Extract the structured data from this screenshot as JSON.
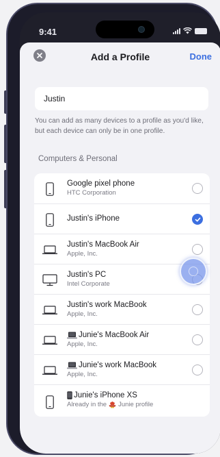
{
  "status_bar": {
    "time": "9:41"
  },
  "nav": {
    "title": "Add a Profile",
    "done_label": "Done"
  },
  "profile_name": {
    "value": "Justin"
  },
  "helper_text": "You can add as many devices to a profile as you'd like, but each device can only be in one profile.",
  "section_title": "Computers & Personal",
  "devices": [
    {
      "icon": "phone-icon",
      "title": "Google pixel phone",
      "subtitle": "HTC Corporation",
      "selected": false
    },
    {
      "icon": "phone-icon",
      "title": "Justin's iPhone",
      "subtitle": "",
      "selected": true
    },
    {
      "icon": "laptop-icon",
      "title": "Justin's MacBook Air",
      "subtitle": "Apple, Inc.",
      "selected": false
    },
    {
      "icon": "desktop-icon",
      "title": "Justin's PC",
      "subtitle": "Intel Corporate",
      "selected": false
    },
    {
      "icon": "laptop-icon",
      "title": "Justin's work MacBook",
      "subtitle": "Apple, Inc.",
      "selected": false
    },
    {
      "icon": "laptop-icon",
      "title": "Junie's MacBook Air",
      "subtitle": "Apple, Inc.",
      "selected": false
    },
    {
      "icon": "laptop-icon",
      "title": "Junie's work MacBook",
      "subtitle": "Apple, Inc.",
      "selected": false
    },
    {
      "icon": "phone-icon",
      "title": "Junie's iPhone XS",
      "subtitle_prefix": "Already in the",
      "subtitle_suffix": "Junie profile"
    }
  ],
  "colors": {
    "accent": "#3c6fe0",
    "sheet_background": "#f2f2f6",
    "phone_frame": "#1c1c2a"
  }
}
